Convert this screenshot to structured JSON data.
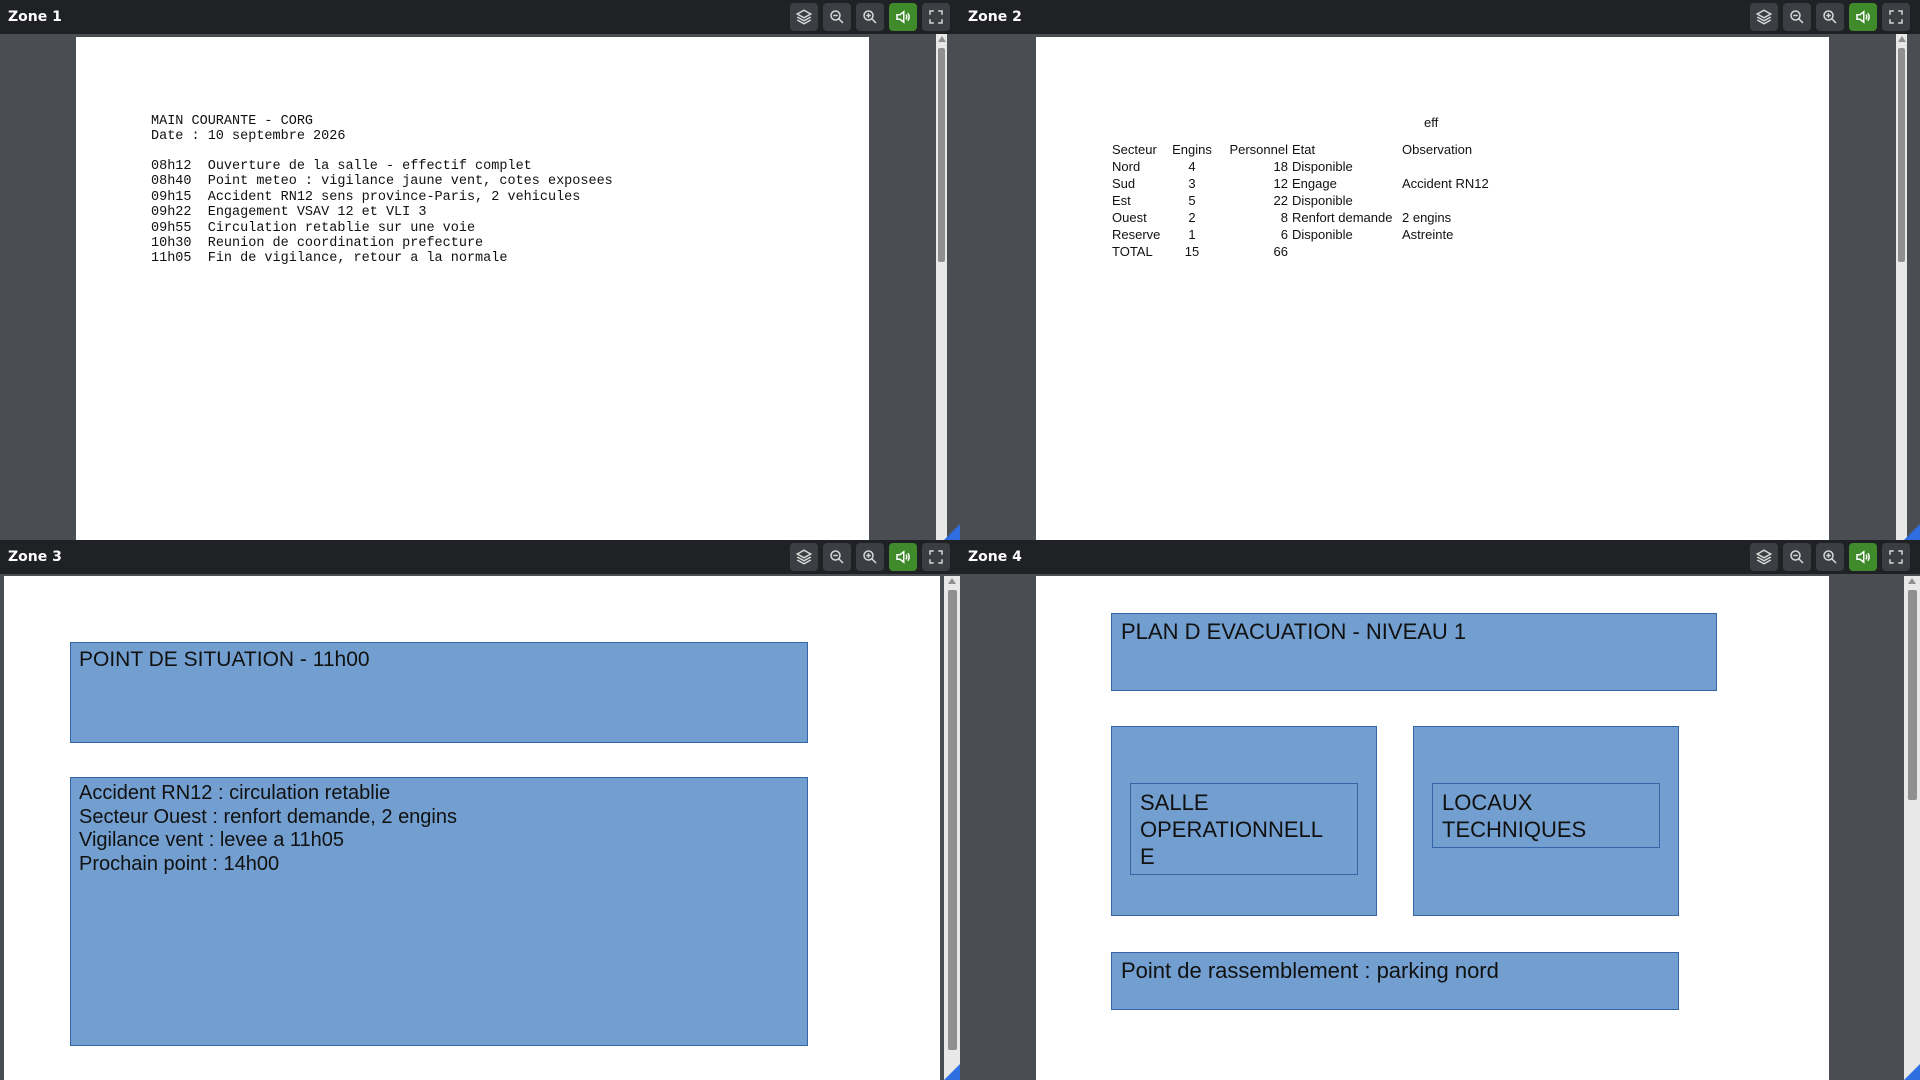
{
  "toolbar": {
    "icons": [
      "layers-icon",
      "zoom-out-icon",
      "zoom-in-icon",
      "speaker-icon",
      "fullscreen-icon"
    ],
    "active_color": "#3f8a2a",
    "accent": "#2f6ee0"
  },
  "zones": [
    {
      "title": "Zone 1",
      "doc": {
        "heading": "MAIN COURANTE - CORG",
        "date": "Date : 10 septembre 2026",
        "entries": [
          {
            "time": "08h12",
            "text": "Ouverture de la salle - effectif complet"
          },
          {
            "time": "08h40",
            "text": "Point meteo : vigilance jaune vent, cotes exposees"
          },
          {
            "time": "09h15",
            "text": "Accident RN12 sens province-Paris, 2 vehicules"
          },
          {
            "time": "09h22",
            "text": "Engagement VSAV 12 et VLI 3"
          },
          {
            "time": "09h55",
            "text": "Circulation retablie sur une voie"
          },
          {
            "time": "10h30",
            "text": "Reunion de coordination prefecture"
          },
          {
            "time": "11h05",
            "text": "Fin de vigilance, retour a la normale"
          }
        ]
      }
    },
    {
      "title": "Zone 2",
      "sheet": {
        "top_cell": "eff",
        "headers": [
          "Secteur",
          "Engins",
          "Personnel",
          "Etat",
          "Observation"
        ],
        "rows": [
          [
            "Nord",
            "4",
            "18",
            "Disponible",
            ""
          ],
          [
            "Sud",
            "3",
            "12",
            "Engage",
            "Accident RN12"
          ],
          [
            "Est",
            "5",
            "22",
            "Disponible",
            ""
          ],
          [
            "Ouest",
            "2",
            "8",
            "Renfort demande",
            "2 engins"
          ],
          [
            "Reserve",
            "1",
            "6",
            "Disponible",
            "Astreinte"
          ],
          [
            "TOTAL",
            "15",
            "66",
            "",
            ""
          ]
        ]
      }
    },
    {
      "title": "Zone 3",
      "slide": {
        "title": "POINT DE SITUATION - 11h00",
        "lines": [
          "Accident RN12 : circulation retablie",
          "Secteur Ouest : renfort demande, 2 engins",
          "Vigilance vent : levee a 11h05",
          "Prochain point : 14h00"
        ]
      }
    },
    {
      "title": "Zone 4",
      "plan": {
        "title": "PLAN D EVACUATION - NIVEAU 1",
        "room1": "SALLE\nOPERATIONNELL\nE",
        "room2": "LOCAUX\nTECHNIQUES",
        "assembly": "Point de rassemblement : parking nord"
      }
    }
  ]
}
